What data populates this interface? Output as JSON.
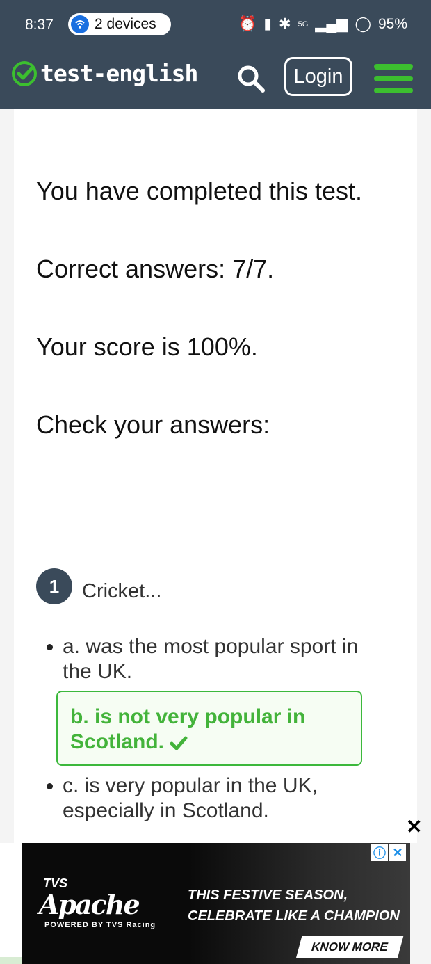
{
  "status_bar": {
    "time": "8:37",
    "devices": "2 devices",
    "battery": "95%",
    "network": "5G"
  },
  "header": {
    "logo_text": "test-english",
    "login_label": "Login",
    "accent_color": "#3cbf2f",
    "bg_color": "#3a4a5a"
  },
  "results": {
    "completed": "You have completed this test.",
    "correct": "Correct answers: 7/7.",
    "score": "Your score is 100%.",
    "check": "Check your answers:"
  },
  "question": {
    "number": "1",
    "text": "Cricket...",
    "options": [
      {
        "label": "a. was the most popular sport in the UK.",
        "correct": false
      },
      {
        "label": "b. is not very popular in Scotland.",
        "correct": true
      },
      {
        "label": "c. is very popular in the UK, especially in Scotland.",
        "correct": false
      }
    ]
  },
  "ad": {
    "brand": "TVS",
    "logo": "Apache",
    "powered": "POWERED BY TVS Racing",
    "headline": "THIS FESTIVE SEASON, CELEBRATE LIKE A CHAMPION",
    "cta": "KNOW MORE"
  }
}
